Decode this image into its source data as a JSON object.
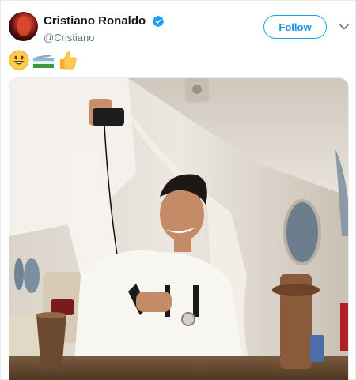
{
  "user": {
    "display_name": "Cristiano Ronaldo",
    "handle": "@Cristiano",
    "verified_icon": "verified-badge-icon",
    "avatar_icon": "avatar"
  },
  "actions": {
    "follow_label": "Follow",
    "menu_icon": "chevron-down-icon"
  },
  "tweet": {
    "emojis": [
      "grinning-face-emoji",
      "airplane-flag-emoji",
      "thumbs-up-emoji"
    ]
  },
  "colors": {
    "accent": "#1da1f2",
    "accent_text": "#1b95e0",
    "handle": "#657786",
    "name": "#14171a"
  }
}
